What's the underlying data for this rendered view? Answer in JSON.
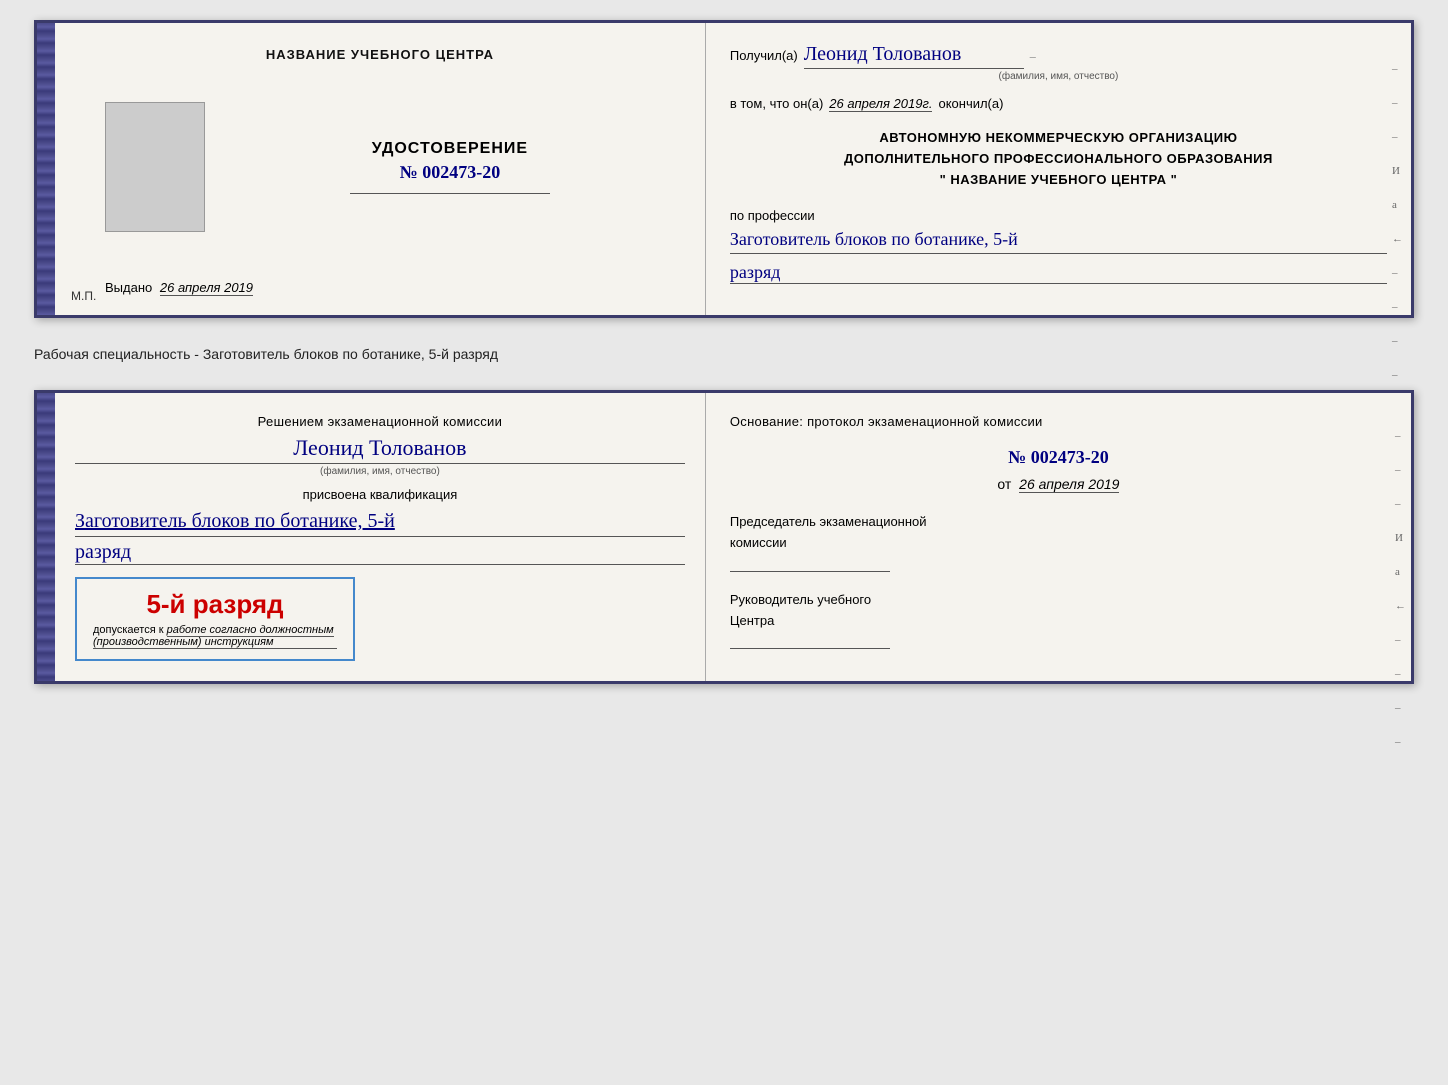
{
  "top_cert": {
    "left": {
      "training_center_label": "НАЗВАНИЕ УЧЕБНОГО ЦЕНТРА",
      "cert_title": "УДОСТОВЕРЕНИЕ",
      "cert_number": "№ 002473-20",
      "issued_label": "Выдано",
      "issued_date": "26 апреля 2019",
      "mp_label": "М.П."
    },
    "right": {
      "received_label": "Получил(а)",
      "recipient_name": "Леонид Толованов",
      "fio_label": "(фамилия, имя, отчество)",
      "certify_text": "в том, что он(а)",
      "certify_date": "26 апреля 2019г.",
      "certify_finished": "окончил(а)",
      "org_line1": "АВТОНОМНУЮ НЕКОММЕРЧЕСКУЮ ОРГАНИЗАЦИЮ",
      "org_line2": "ДОПОЛНИТЕЛЬНОГО ПРОФЕССИОНАЛЬНОГО ОБРАЗОВАНИЯ",
      "org_name": "\" НАЗВАНИЕ УЧЕБНОГО ЦЕНТРА \"",
      "profession_label": "по профессии",
      "profession_value": "Заготовитель блоков по ботанике, 5-й",
      "rank_value": "разряд"
    }
  },
  "separator": {
    "text": "Рабочая специальность - Заготовитель блоков по ботанике, 5-й разряд"
  },
  "bottom_cert": {
    "left": {
      "decision_text": "Решением экзаменационной комиссии",
      "person_name": "Леонид Толованов",
      "fio_label": "(фамилия, имя, отчество)",
      "assigned_text": "присвоена квалификация",
      "profession_value": "Заготовитель блоков по ботанике, 5-й",
      "rank_value": "разряд",
      "stamp_rank": "5-й разряд",
      "stamp_allowed_prefix": "допускается к",
      "stamp_italic": "работе согласно должностным",
      "stamp_italic2": "(производственным) инструкциям"
    },
    "right": {
      "basis_text": "Основание: протокол экзаменационной комиссии",
      "protocol_number": "№ 002473-20",
      "date_prefix": "от",
      "date_value": "26 апреля 2019",
      "chairman_label": "Председатель экзаменационной",
      "chairman_label2": "комиссии",
      "director_label": "Руководитель учебного",
      "director_label2": "Центра"
    }
  },
  "side_marks": [
    "-",
    "-",
    "-",
    "И",
    "а",
    "←",
    "-",
    "-",
    "-",
    "-"
  ]
}
